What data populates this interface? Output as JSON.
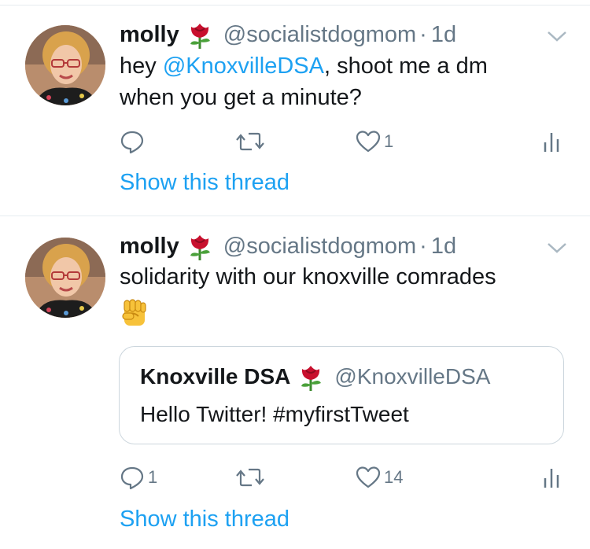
{
  "tweets": [
    {
      "author_name": "molly",
      "author_emoji": "rose-emoji",
      "handle": "@socialistdogmom",
      "dot": "·",
      "time": "1d",
      "text_prefix": "hey ",
      "mention": "@KnoxvilleDSA",
      "text_suffix_line1": ", shoot me a dm",
      "text_line2": "when you get a minute?",
      "reply_count": "",
      "retweet_count": "",
      "like_count": "1",
      "show_thread": "Show this thread"
    },
    {
      "author_name": "molly",
      "author_emoji": "rose-emoji",
      "handle": "@socialistdogmom",
      "dot": "·",
      "time": "1d",
      "text_line1": "solidarity with our knoxville comrades",
      "text_emoji": "raised-fist-emoji",
      "quoted": {
        "author_name": "Knoxville DSA",
        "author_emoji": "rose-emoji",
        "handle": "@KnoxvilleDSA",
        "text": "Hello Twitter! #myfirstTweet"
      },
      "reply_count": "1",
      "retweet_count": "",
      "like_count": "14",
      "show_thread": "Show this thread"
    }
  ],
  "colors": {
    "link": "#1da1f2",
    "muted": "#657786",
    "text": "#14171a",
    "divider": "#e6ecf0"
  },
  "icons": [
    "reply-icon",
    "retweet-icon",
    "like-icon",
    "analytics-icon",
    "chevron-down-icon"
  ]
}
